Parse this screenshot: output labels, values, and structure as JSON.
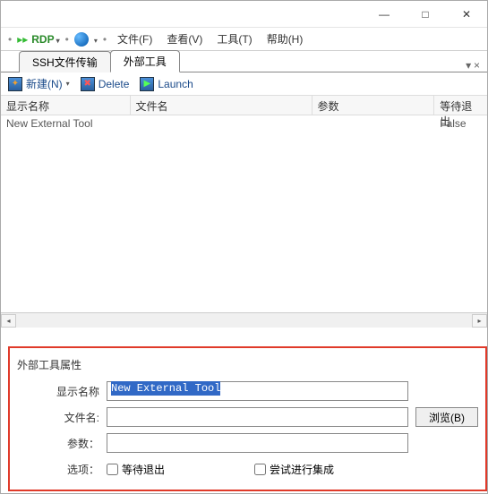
{
  "window": {
    "min": "—",
    "max": "□",
    "close": "✕"
  },
  "toolbar1": {
    "rdp": "RDP",
    "menus": {
      "file": "文件(F)",
      "view": "查看(V)",
      "tools": "工具(T)",
      "help": "帮助(H)"
    }
  },
  "tabs": {
    "ssh": "SSH文件传输",
    "external": "外部工具",
    "dropdown": "▾",
    "close": "×"
  },
  "toolbar2": {
    "new": "新建(N)",
    "delete": "Delete",
    "launch": "Launch"
  },
  "grid": {
    "headers": {
      "name": "显示名称",
      "file": "文件名",
      "param": "参数",
      "wait": "等待退出"
    },
    "rows": [
      {
        "name": "New External Tool",
        "file": "",
        "param": "",
        "wait": "False"
      }
    ]
  },
  "props": {
    "title": "外部工具属性",
    "labels": {
      "name": "显示名称",
      "file": "文件名:",
      "param": "参数：",
      "options": "选项："
    },
    "values": {
      "name": "New External Tool",
      "file": "",
      "param": ""
    },
    "browse": "浏览(B)",
    "checkboxes": {
      "wait_exit": "等待退出",
      "try_integrate": "尝试进行集成"
    }
  }
}
